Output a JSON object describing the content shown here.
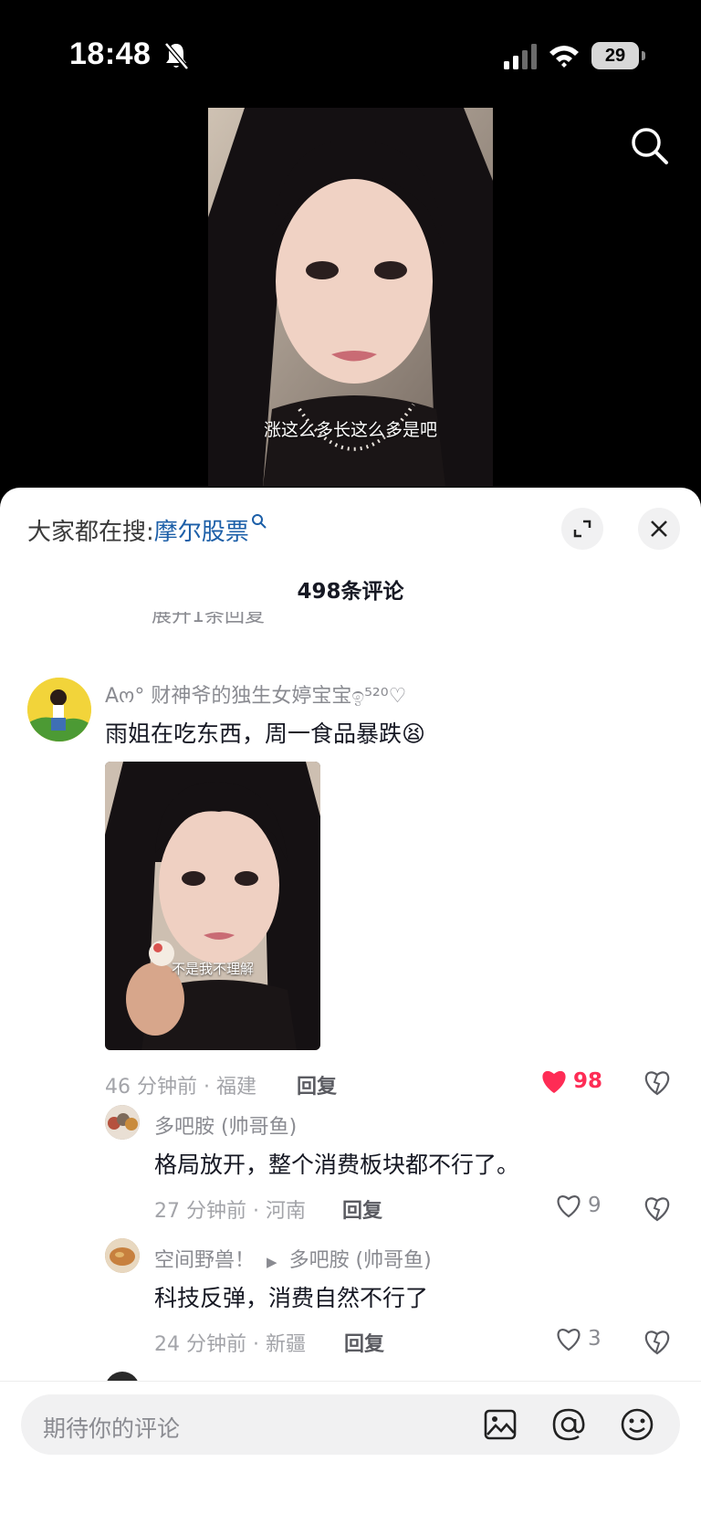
{
  "status": {
    "time": "18:48",
    "battery": "29"
  },
  "video": {
    "caption": "涨这么多长这么多是吧"
  },
  "sheet": {
    "hot_search_prefix": "大家都在搜:",
    "hot_search_keyword": "摩尔股票",
    "comment_count": "498条评论",
    "collapsed_hint": "展开1条回复"
  },
  "comments": [
    {
      "user": "Aო° 财神爷的独生女婷宝宝ඉ⁵²⁰♡",
      "text": "雨姐在吃东西，周一食品暴跌",
      "emoji": "😫",
      "image_caption": "不是我不理解",
      "meta": "46 分钟前 · 福建",
      "reply": "回复",
      "likes": "98",
      "liked": true
    }
  ],
  "replies": [
    {
      "user": "多吧胺 (帅哥鱼)",
      "text": "格局放开，整个消费板块都不行了。",
      "meta": "27 分钟前 · 河南",
      "reply": "回复",
      "likes": "9"
    },
    {
      "user": "空间野兽！",
      "reply_to": "多吧胺 (帅哥鱼)",
      "text": "科技反弹，消费自然不行了",
      "meta": "24 分钟前 · 新疆",
      "reply": "回复",
      "likes": "3"
    }
  ],
  "input": {
    "placeholder": "期待你的评论"
  },
  "colors": {
    "accent_red": "#fe2c55",
    "keyword_blue": "#1c5fa8"
  }
}
